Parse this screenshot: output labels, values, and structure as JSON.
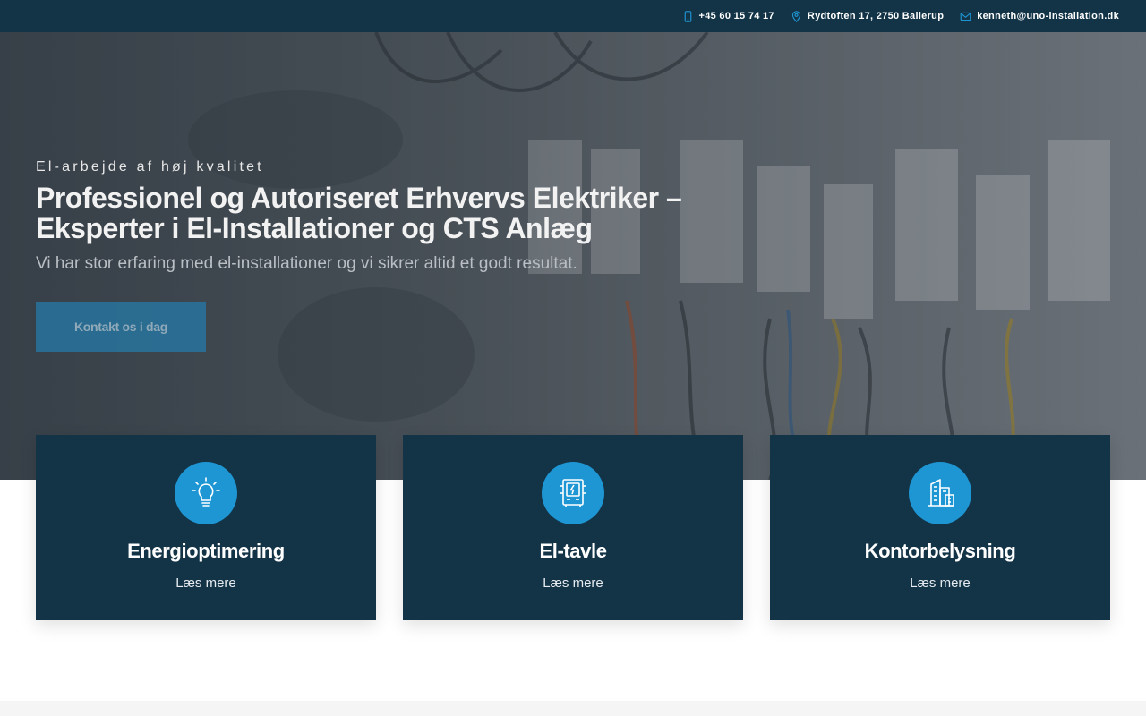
{
  "topbar": {
    "phone": "+45 60 15 74 17",
    "address": "Rydtoften 17, 2750 Ballerup",
    "email": "kenneth@uno-installation.dk",
    "icons": [
      "phone-icon",
      "map-pin-icon",
      "mail-icon"
    ],
    "icon_color": "#1e96d3",
    "background": "#133347"
  },
  "hero": {
    "eyebrow": "El-arbejde af høj kvalitet",
    "title_line1": "Professionel og Autoriseret Erhvervs Elektriker –",
    "title_line2": "Eksperter i El-Installationer og CTS Anlæg",
    "subtitle": "Vi har stor erfaring med el-installationer og vi sikrer altid et godt resultat.",
    "cta_label": "Kontakt os i dag"
  },
  "services": [
    {
      "title": "Energioptimering",
      "link": "Læs mere",
      "icon": "lightbulb-icon"
    },
    {
      "title": "El-tavle",
      "link": "Læs mere",
      "icon": "electrical-panel-icon"
    },
    {
      "title": "Kontorbelysning",
      "link": "Læs mere",
      "icon": "office-building-icon"
    }
  ],
  "colors": {
    "navy": "#133347",
    "accent": "#1e96d3"
  }
}
